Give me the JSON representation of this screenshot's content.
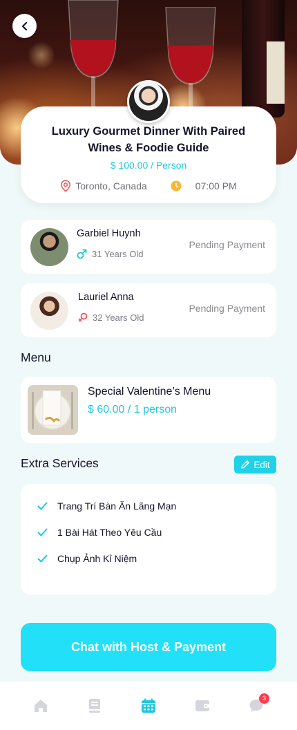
{
  "event": {
    "title": "Luxury Gourmet Dinner With Paired Wines & Foodie Guide",
    "price": "$ 100.00",
    "price_unit": " / Person",
    "location": "Toronto, Canada",
    "time": "07:00 PM"
  },
  "guests": [
    {
      "name": "Garbiel Huynh",
      "age": "31 Years Old",
      "gender": "male",
      "status": "Pending Payment"
    },
    {
      "name": "Lauriel Anna",
      "age": "32 Years Old",
      "gender": "female",
      "status": "Pending Payment"
    }
  ],
  "menu": {
    "section_title": "Menu",
    "item_name": "Special Valentine’s Menu",
    "item_price": "$ 60.00 / 1 person"
  },
  "extras": {
    "section_title": "Extra Services",
    "edit_label": "Edit",
    "items": [
      "Trang Trí Bàn Ăn Lãng Mạn",
      "1 Bài Hát Theo Yêu Cầu",
      "Chụp Ảnh Kỉ Niệm"
    ]
  },
  "cta_label": "Chat with Host & Payment",
  "nav": {
    "items": [
      "home-icon",
      "book-icon",
      "calendar-icon",
      "wallet-icon",
      "chat-icon"
    ],
    "active": "calendar-icon",
    "chat_badge": "3"
  },
  "colors": {
    "accent": "#1fc7dd",
    "cta": "#22e0f7",
    "background": "#f0f9f9",
    "badge": "#ff3b4b"
  }
}
